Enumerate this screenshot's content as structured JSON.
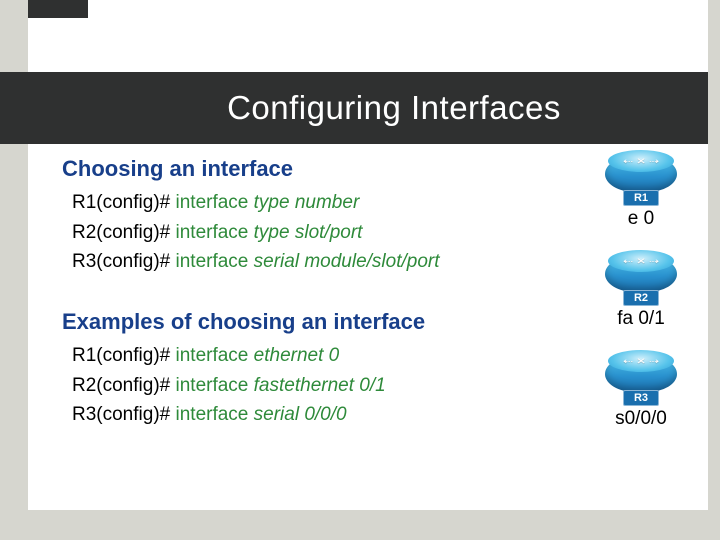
{
  "title": "Configuring Interfaces",
  "section1": {
    "heading": "Choosing an interface",
    "lines": [
      {
        "prompt": "R1(config)# ",
        "kw": "interface ",
        "arg": "type number"
      },
      {
        "prompt": "R2(config)# ",
        "kw": "interface ",
        "arg": "type slot/port"
      },
      {
        "prompt": "R3(config)# ",
        "kw": "interface ",
        "arg": "serial module/slot/port"
      }
    ]
  },
  "section2": {
    "heading": "Examples of choosing an interface",
    "lines": [
      {
        "prompt": "R1(config)# ",
        "kw": "interface ",
        "arg": "ethernet 0"
      },
      {
        "prompt": "R2(config)# ",
        "kw": "interface ",
        "arg": "fastethernet 0/1"
      },
      {
        "prompt": "R3(config)# ",
        "kw": "interface ",
        "arg": "serial 0/0/0"
      }
    ]
  },
  "routers": [
    {
      "name": "R1",
      "iface": "e 0"
    },
    {
      "name": "R2",
      "iface": "fa 0/1"
    },
    {
      "name": "R3",
      "iface": "s0/0/0"
    }
  ]
}
